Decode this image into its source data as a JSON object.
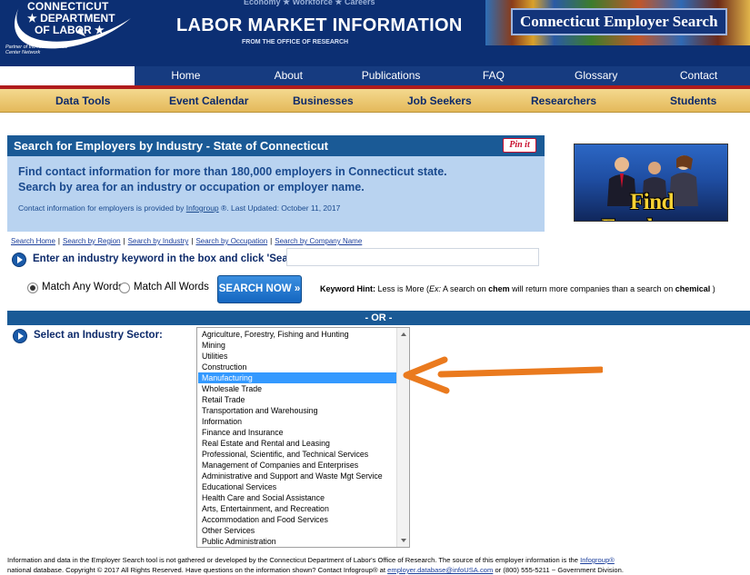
{
  "header": {
    "logo_line1": "CONNECTICUT",
    "logo_line2": "★ DEPARTMENT",
    "logo_line3": "OF LABOR ★",
    "logo_partner": "Partner of the American Job Center Network",
    "topline": "Economy  ★  Workforce  ★  Careers",
    "title": "LABOR MARKET INFORMATION",
    "subtitle": "FROM THE OFFICE OF RESEARCH",
    "banner": "Connecticut Employer Search"
  },
  "main_nav": [
    "Home",
    "About",
    "Publications",
    "FAQ",
    "Glossary",
    "Contact"
  ],
  "sub_nav": [
    "Data Tools",
    "Event Calendar",
    "Businesses",
    "Job Seekers",
    "Researchers",
    "Students"
  ],
  "panel": {
    "title": "Search for Employers by Industry - State of Connecticut",
    "pinit": "Pin it",
    "lead_line1": "Find contact information for more than 180,000 employers in Connecticut state.",
    "lead_line2": "Search by area for an industry or occupation or employer name.",
    "note_prefix": "Contact information for employers is provided by ",
    "note_link": "Infogroup",
    "note_suffix": " ®.   Last Updated: October 11, 2017"
  },
  "find_employers": "Find Employers",
  "search_links": [
    "Search Home",
    "Search by Region",
    "Search by Industry",
    "Search by Occupation",
    "Search by Company Name"
  ],
  "keyword": {
    "prompt": "Enter an industry keyword in the box and click 'Search'",
    "value": "",
    "match_any": "Match Any Words",
    "match_all": "Match All Words",
    "button": "SEARCH NOW »",
    "hint_label": "Keyword Hint:",
    "hint_text1": " Less is More (",
    "hint_ex": "Ex:",
    "hint_text2": " A search on ",
    "hint_chem": "chem",
    "hint_text3": " will return more companies than a search on ",
    "hint_chemical": "chemical",
    "hint_text4": " )"
  },
  "or_label": "- OR -",
  "sector": {
    "label": "Select an Industry Sector:",
    "selected": "Manufacturing",
    "options": [
      "Agriculture, Forestry, Fishing and Hunting",
      "Mining",
      "Utilities",
      "Construction",
      "Manufacturing",
      "Wholesale Trade",
      "Retail Trade",
      "Transportation and Warehousing",
      "Information",
      "Finance and Insurance",
      "Real Estate and Rental and Leasing",
      "Professional, Scientific, and Technical Services",
      "Management of Companies and Enterprises",
      "Administrative and Support and Waste Mgt Service",
      "Educational Services",
      "Health Care and Social Assistance",
      "Arts, Entertainment, and Recreation",
      "Accommodation and Food Services",
      "Other Services",
      "Public Administration"
    ]
  },
  "colors": {
    "accent_arrow": "#ea7a1e",
    "selected_bg": "#3399ff",
    "nav_blue": "#163b80"
  },
  "footer": {
    "line1_text": "Information and data in the Employer Search tool is not gathered or developed by the Connecticut Department of Labor's Office of Research. The source of this employer information is the ",
    "line1_link": "Infogroup®",
    "line2_text": "national database. Copyright © 2017 All Rights Reserved. Have questions on the information shown? Contact Infogroup® at ",
    "line2_email": "employer.database@infoUSA.com",
    "line2_tail": " or (800) 555-5211 ~ Government Division."
  }
}
